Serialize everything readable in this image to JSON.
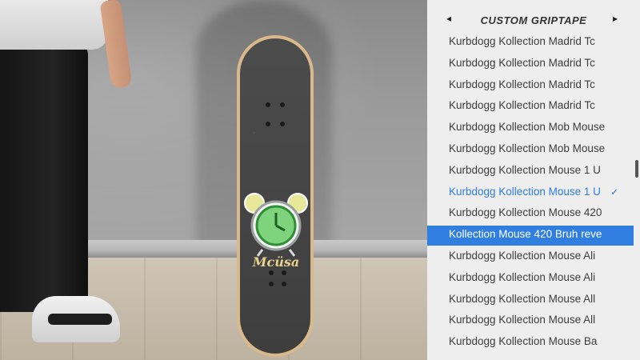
{
  "panel": {
    "title": "CUSTOM GRIPTAPE",
    "prev_arrow": "◂",
    "next_arrow": "▸",
    "check_mark": "✓",
    "items": [
      {
        "label": "Kurbdogg Kollection Madrid Tc"
      },
      {
        "label": "Kurbdogg Kollection Madrid Tc"
      },
      {
        "label": "Kurbdogg Kollection Madrid Tc"
      },
      {
        "label": "Kurbdogg Kollection Madrid Tc"
      },
      {
        "label": "Kurbdogg Kollection Mob Mouse"
      },
      {
        "label": "Kurbdogg Kollection Mob Mouse"
      },
      {
        "label": "Kurbdogg Kollection Mouse 1 U"
      },
      {
        "label": "Kurbdogg Kollection Mouse 1 U"
      },
      {
        "label": "Kurbdogg Kollection Mouse 420"
      },
      {
        "label": "Kollection Mouse 420 Bruh reve"
      },
      {
        "label": "Kurbdogg Kollection Mouse Ali"
      },
      {
        "label": "Kurbdogg Kollection Mouse Ali"
      },
      {
        "label": "Kurbdogg Kollection Mouse All"
      },
      {
        "label": "Kurbdogg Kollection Mouse All"
      },
      {
        "label": "Kurbdogg Kollection Mouse Ba"
      }
    ],
    "equipped_index": 7,
    "highlighted_index": 9,
    "scroll_fraction": 0.4
  },
  "colors": {
    "panel_bg": "#eeeeee",
    "text": "#3d3d3d",
    "equipped_text": "#2f7ee0",
    "highlight_bg": "#2f7ee0",
    "highlight_text": "#ffffff"
  },
  "scene": {
    "deck_graphic_text": "Mcüsa"
  }
}
